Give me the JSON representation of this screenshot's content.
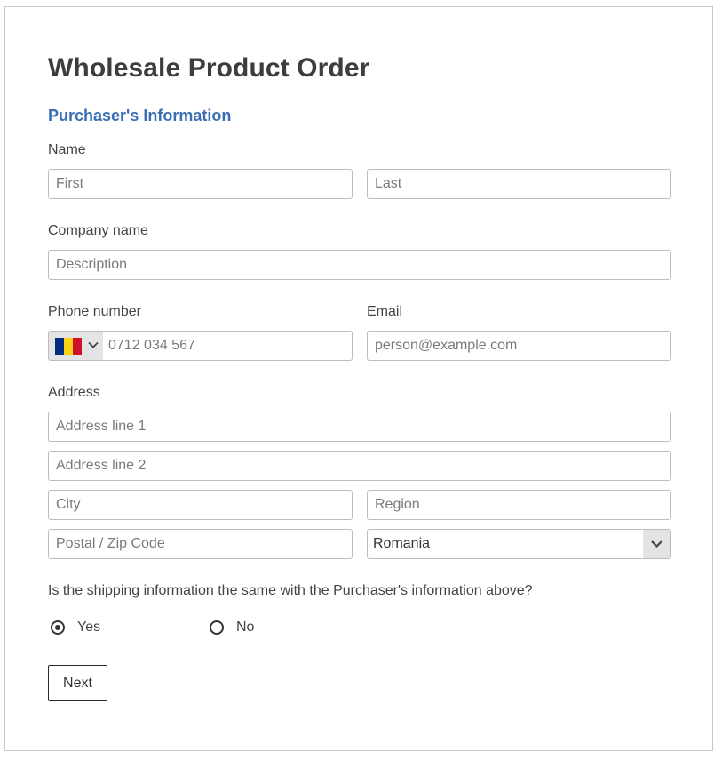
{
  "form": {
    "title": "Wholesale Product Order",
    "section_title": "Purchaser's Information",
    "name": {
      "label": "Name",
      "first_placeholder": "First",
      "last_placeholder": "Last"
    },
    "company": {
      "label": "Company name",
      "placeholder": "Description"
    },
    "phone": {
      "label": "Phone number",
      "placeholder": "0712 034 567",
      "flag_colors": [
        "#002b7f",
        "#fcd116",
        "#ce1126"
      ]
    },
    "email": {
      "label": "Email",
      "placeholder": "person@example.com"
    },
    "address": {
      "label": "Address",
      "line1_placeholder": "Address line 1",
      "line2_placeholder": "Address line 2",
      "city_placeholder": "City",
      "region_placeholder": "Region",
      "postal_placeholder": "Postal / Zip Code",
      "country_value": "Romania"
    },
    "shipping_question": "Is the shipping information the same with the Purchaser's information above?",
    "options": [
      {
        "label": "Yes",
        "checked": true
      },
      {
        "label": "No",
        "checked": false
      }
    ],
    "next_label": "Next"
  },
  "colors": {
    "accent": "#3a6fb4",
    "border": "#bdbdbd",
    "control_bg": "#e4e4e4"
  }
}
